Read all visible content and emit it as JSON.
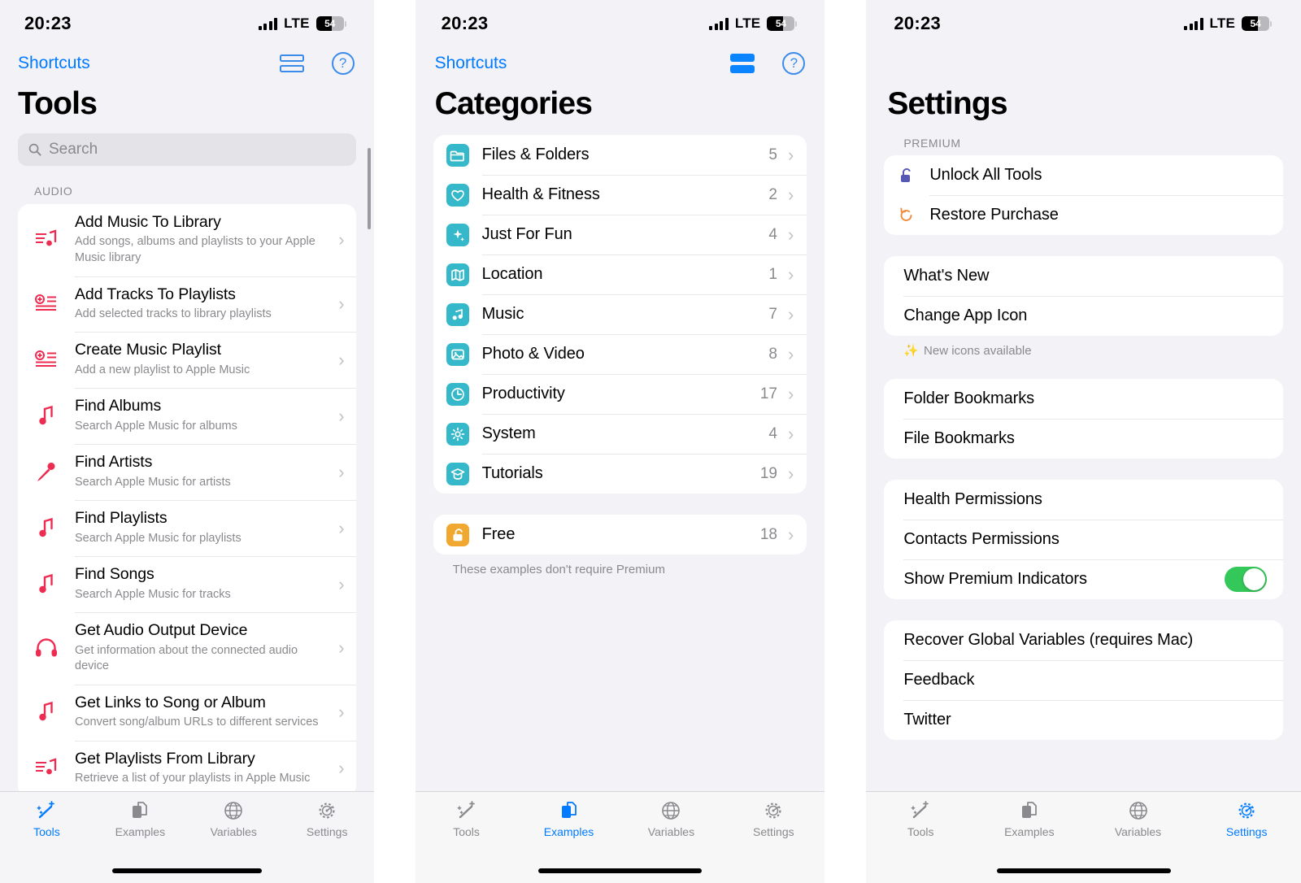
{
  "status_bar": {
    "time": "20:23",
    "network": "LTE",
    "battery_percent": "54"
  },
  "colors": {
    "accent_blue": "#007aff",
    "category_teal": "#35b8c9",
    "free_orange": "#f0a830",
    "music_red": "#ee2c51",
    "toggle_green": "#34c759",
    "unlock_indigo": "#5559b5",
    "restore_orange": "#f08b3a"
  },
  "tabs": [
    {
      "label": "Tools",
      "icon": "magic-wand-icon"
    },
    {
      "label": "Examples",
      "icon": "documents-stack-icon"
    },
    {
      "label": "Variables",
      "icon": "globe-icon"
    },
    {
      "label": "Settings",
      "icon": "gear-icon"
    }
  ],
  "panel_tools": {
    "back_label": "Shortcuts",
    "layout_icon": "rows-layout-icon",
    "help_icon": "help-circle-icon",
    "title": "Tools",
    "search_placeholder": "Search",
    "section_label": "AUDIO",
    "active_tab": "Tools",
    "items": [
      {
        "title": "Add Music To Library",
        "subtitle": "Add songs, albums and playlists to your Apple Music library",
        "icon": "music-list-icon"
      },
      {
        "title": "Add Tracks To Playlists",
        "subtitle": "Add selected tracks to library playlists",
        "icon": "playlist-add-icon"
      },
      {
        "title": "Create Music Playlist",
        "subtitle": "Add a new playlist to Apple Music",
        "icon": "playlist-add-icon"
      },
      {
        "title": "Find Albums",
        "subtitle": "Search Apple Music for albums",
        "icon": "music-note-icon"
      },
      {
        "title": "Find Artists",
        "subtitle": "Search Apple Music for artists",
        "icon": "microphone-icon"
      },
      {
        "title": "Find Playlists",
        "subtitle": "Search Apple Music for playlists",
        "icon": "music-note-icon"
      },
      {
        "title": "Find Songs",
        "subtitle": "Search Apple Music for tracks",
        "icon": "music-note-icon"
      },
      {
        "title": "Get Audio Output Device",
        "subtitle": "Get information about the connected audio device",
        "icon": "headphones-icon"
      },
      {
        "title": "Get Links to Song or Album",
        "subtitle": "Convert song/album URLs to different services",
        "icon": "music-note-icon"
      },
      {
        "title": "Get Playlists From Library",
        "subtitle": "Retrieve a list of your playlists in Apple Music",
        "icon": "music-list-icon"
      }
    ]
  },
  "panel_categories": {
    "back_label": "Shortcuts",
    "layout_icon": "rows-layout-icon",
    "help_icon": "help-circle-icon",
    "title": "Categories",
    "active_tab": "Examples",
    "items": [
      {
        "label": "Files & Folders",
        "count": "5",
        "icon": "folder-icon"
      },
      {
        "label": "Health & Fitness",
        "count": "2",
        "icon": "heart-icon"
      },
      {
        "label": "Just For Fun",
        "count": "4",
        "icon": "sparkles-icon"
      },
      {
        "label": "Location",
        "count": "1",
        "icon": "map-icon"
      },
      {
        "label": "Music",
        "count": "7",
        "icon": "music-note-icon"
      },
      {
        "label": "Photo & Video",
        "count": "8",
        "icon": "photo-icon"
      },
      {
        "label": "Productivity",
        "count": "17",
        "icon": "clock-icon"
      },
      {
        "label": "System",
        "count": "4",
        "icon": "gear-icon"
      },
      {
        "label": "Tutorials",
        "count": "19",
        "icon": "graduation-cap-icon"
      }
    ],
    "free": {
      "label": "Free",
      "count": "18",
      "icon": "unlock-icon"
    },
    "free_footnote": "These examples don't require Premium"
  },
  "panel_settings": {
    "title": "Settings",
    "active_tab": "Settings",
    "premium_header": "PREMIUM",
    "premium_items": [
      {
        "label": "Unlock All Tools",
        "icon": "unlock-icon"
      },
      {
        "label": "Restore Purchase",
        "icon": "restore-arrow-icon"
      }
    ],
    "app_items": [
      {
        "label": "What's New"
      },
      {
        "label": "Change App Icon"
      }
    ],
    "app_footnote": "New icons available",
    "app_footnote_icon": "sparkles-icon",
    "bookmark_items": [
      {
        "label": "Folder Bookmarks"
      },
      {
        "label": "File Bookmarks"
      }
    ],
    "permission_items": [
      {
        "label": "Health Permissions",
        "type": "link"
      },
      {
        "label": "Contacts Permissions",
        "type": "link"
      },
      {
        "label": "Show Premium Indicators",
        "type": "toggle",
        "value": "on"
      }
    ],
    "misc_items": [
      {
        "label": "Recover Global Variables (requires Mac)"
      },
      {
        "label": "Feedback"
      },
      {
        "label": "Twitter"
      }
    ]
  }
}
